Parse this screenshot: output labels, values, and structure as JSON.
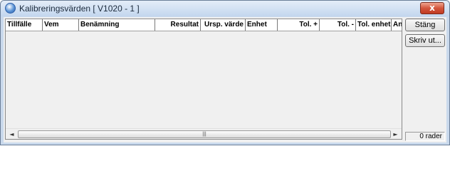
{
  "window": {
    "title": "Kalibreringsvärden  [ V1020 - 1 ]",
    "close_label": "x"
  },
  "grid": {
    "columns": [
      {
        "label": "Tillfälle",
        "align": "left"
      },
      {
        "label": "Vem",
        "align": "left"
      },
      {
        "label": "Benämning",
        "align": "left"
      },
      {
        "label": "Resultat",
        "align": "right"
      },
      {
        "label": "Ursp. värde",
        "align": "right"
      },
      {
        "label": "Enhet",
        "align": "left"
      },
      {
        "label": "Tol. +",
        "align": "right"
      },
      {
        "label": "Tol. -",
        "align": "right"
      },
      {
        "label": "Tol. enhet",
        "align": "left"
      },
      {
        "label": "Anv",
        "align": "left"
      }
    ],
    "rows": [],
    "scroll_left": "◄",
    "scroll_right": "►",
    "scroll_grip": "|||"
  },
  "buttons": {
    "close_label": "Stäng",
    "print_label": "Skriv ut..."
  },
  "status": {
    "row_count": "0 rader"
  }
}
